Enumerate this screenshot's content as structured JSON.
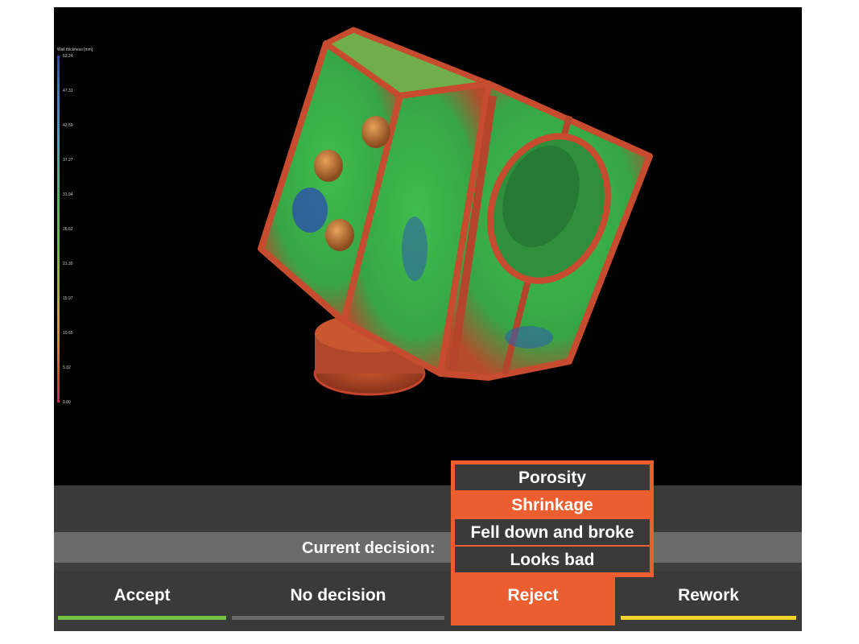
{
  "legend": {
    "title": "Wall thickness [mm]",
    "ticks": [
      "53.24",
      "47.31",
      "42.59",
      "37.27",
      "31.94",
      "26.62",
      "21.30",
      "15.97",
      "10.65",
      "5.32",
      "0.00"
    ]
  },
  "decision": {
    "label": "Current decision:"
  },
  "reject_reasons": [
    {
      "label": "Porosity",
      "selected": false
    },
    {
      "label": "Shrinkage",
      "selected": true
    },
    {
      "label": "Fell down and broke",
      "selected": false
    },
    {
      "label": "Looks bad",
      "selected": false
    }
  ],
  "actions": {
    "accept": "Accept",
    "no_decision": "No decision",
    "reject": "Reject",
    "rework": "Rework"
  },
  "colors": {
    "accept": "#74c044",
    "reject": "#ec5e30",
    "rework": "#f2d32a",
    "panel": "#3a3a3a"
  }
}
